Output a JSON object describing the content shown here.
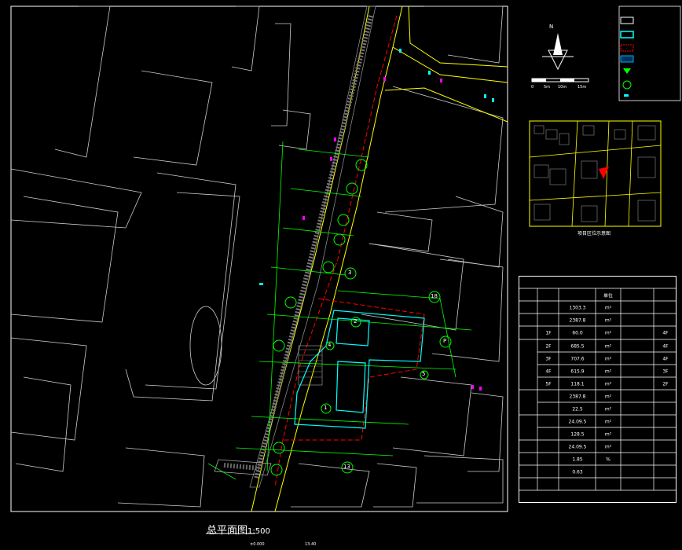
{
  "drawing": {
    "title": "总平面图",
    "scale": "1:500",
    "footer_note": [
      "±0.000",
      "13.40"
    ]
  },
  "minimap": {
    "caption": "项目区位示意图"
  },
  "scale_bar": {
    "labels": [
      "0",
      "5m",
      "10m",
      "15m"
    ]
  },
  "north_arrow": {
    "label": "N"
  },
  "site_labels": {
    "building_markers": [
      "3",
      "18",
      "2",
      "1",
      "4",
      "5",
      "13"
    ],
    "parking": "P",
    "area_texts": [
      "1303.3",
      "2387.8"
    ]
  },
  "table": {
    "columns": [
      "",
      "",
      "单位",
      "",
      ""
    ],
    "rows": [
      [
        "",
        "",
        "1303.3",
        "m²",
        "",
        ""
      ],
      [
        "",
        "",
        "2387.8",
        "m²",
        "",
        ""
      ],
      [
        "",
        "1F",
        "60.0",
        "m²",
        "",
        "4F"
      ],
      [
        "",
        "2F",
        "685.5",
        "m²",
        "",
        "4F"
      ],
      [
        "",
        "3F",
        "707.6",
        "m²",
        "",
        "4F"
      ],
      [
        "",
        "4F",
        "615.9",
        "m²",
        "",
        "3F"
      ],
      [
        "",
        "5F",
        "118.1",
        "m²",
        "",
        "2F"
      ],
      [
        "",
        "",
        "2387.8",
        "m²",
        "",
        ""
      ],
      [
        "",
        "",
        "22.5",
        "m²",
        "",
        ""
      ],
      [
        "",
        "",
        "24.09.5",
        "m²",
        "",
        ""
      ],
      [
        "",
        "",
        "128.5",
        "m²",
        "",
        ""
      ],
      [
        "",
        "",
        "24.09.5",
        "m²",
        "",
        ""
      ],
      [
        "",
        "",
        "1.85",
        "%",
        "",
        ""
      ],
      [
        "",
        "",
        "0.63",
        "",
        "",
        ""
      ],
      [
        "",
        "",
        "",
        "",
        "",
        ""
      ],
      [
        "",
        "",
        "",
        "",
        "",
        ""
      ]
    ]
  },
  "colors": {
    "road": "#ffff00",
    "site": "#00ffff",
    "redline": "#ff0000",
    "green": "#00ff00",
    "hatch": "#00aaff",
    "marker": "#ff00ff"
  }
}
